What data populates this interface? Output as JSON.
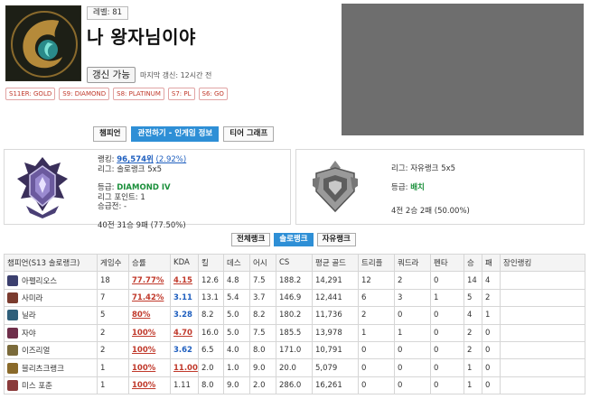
{
  "profile": {
    "level_label": "레벨: 81",
    "summoner_name": "나 왕자님이야",
    "renew_label": "갱신 가능",
    "last_update": "마지막 갱신: 12시간 전",
    "season_badges": [
      "S11ER: GOLD",
      "S9: DIAMOND",
      "S8: PLATINUM",
      "S7: PL",
      "S6: GO"
    ]
  },
  "tabs": [
    "챔피언",
    "관전하기 - 인게임 정보",
    "티어 그래프"
  ],
  "active_tab": 1,
  "solo_rank": {
    "rank_label": "랭킹: ",
    "rank_value": "96,574위",
    "rank_percent": "(2.92%)",
    "league": "리그: 솔로랭크 5x5",
    "tier_label": "등급: ",
    "tier": "DIAMOND IV",
    "league_points": "리그 포인트: 1",
    "promo": "승급전: -",
    "record": "40전 31승 9패 (77.50%)"
  },
  "flex_rank": {
    "league": "리그: 자유랭크 5x5",
    "tier_label": "등급: ",
    "tier": "배치",
    "record": "4전 2승 2패 (50.00%)"
  },
  "queue_buttons": [
    "전체랭크",
    "솔로랭크",
    "자유랭크"
  ],
  "active_queue": 1,
  "table": {
    "headers": [
      "챔피언(S13 솔로랭크)",
      "게임수",
      "승률",
      "KDA",
      "킬",
      "데스",
      "어시",
      "CS",
      "평균 골드",
      "트리플",
      "쿼드라",
      "펜타",
      "승",
      "패",
      "장인랭킹"
    ],
    "rows": [
      {
        "name": "아펠리오스",
        "games": "18",
        "wr": "77.77%",
        "kda": "4.15",
        "k": "12.6",
        "d": "4.8",
        "a": "7.5",
        "cs": "188.2",
        "gold": "14,291",
        "triple": "12",
        "quadra": "2",
        "penta": "0",
        "w": "14",
        "l": "4",
        "rank": "",
        "kda_style": "good",
        "icon_color": "#3b3f6e"
      },
      {
        "name": "사미라",
        "games": "7",
        "wr": "71.42%",
        "kda": "3.11",
        "k": "13.1",
        "d": "5.4",
        "a": "3.7",
        "cs": "146.9",
        "gold": "12,441",
        "triple": "6",
        "quadra": "3",
        "penta": "1",
        "w": "5",
        "l": "2",
        "rank": "",
        "kda_style": "mid",
        "icon_color": "#7a3b2e"
      },
      {
        "name": "닐라",
        "games": "5",
        "wr": "80%",
        "kda": "3.28",
        "k": "8.2",
        "d": "5.0",
        "a": "8.2",
        "cs": "180.2",
        "gold": "11,736",
        "triple": "2",
        "quadra": "0",
        "penta": "0",
        "w": "4",
        "l": "1",
        "rank": "",
        "kda_style": "mid",
        "icon_color": "#2f5f7a"
      },
      {
        "name": "자야",
        "games": "2",
        "wr": "100%",
        "kda": "4.70",
        "k": "16.0",
        "d": "5.0",
        "a": "7.5",
        "cs": "185.5",
        "gold": "13,978",
        "triple": "1",
        "quadra": "1",
        "penta": "0",
        "w": "2",
        "l": "0",
        "rank": "",
        "kda_style": "good",
        "icon_color": "#6e2e4a"
      },
      {
        "name": "이즈리얼",
        "games": "2",
        "wr": "100%",
        "kda": "3.62",
        "k": "6.5",
        "d": "4.0",
        "a": "8.0",
        "cs": "171.0",
        "gold": "10,791",
        "triple": "0",
        "quadra": "0",
        "penta": "0",
        "w": "2",
        "l": "0",
        "rank": "",
        "kda_style": "mid",
        "icon_color": "#7a6a3a"
      },
      {
        "name": "블리츠크랭크",
        "games": "1",
        "wr": "100%",
        "kda": "11.00",
        "k": "2.0",
        "d": "1.0",
        "a": "9.0",
        "cs": "20.0",
        "gold": "5,079",
        "triple": "0",
        "quadra": "0",
        "penta": "0",
        "w": "1",
        "l": "0",
        "rank": "",
        "kda_style": "good",
        "icon_color": "#8a6a2a"
      },
      {
        "name": "미스 포춘",
        "games": "1",
        "wr": "100%",
        "kda": "1.11",
        "k": "8.0",
        "d": "9.0",
        "a": "2.0",
        "cs": "286.0",
        "gold": "16,261",
        "triple": "0",
        "quadra": "0",
        "penta": "0",
        "w": "1",
        "l": "0",
        "rank": "",
        "kda_style": "plain",
        "icon_color": "#8a3a3a"
      }
    ]
  },
  "colors": {
    "accent": "#2e8fd6",
    "win_rate": "#c0392b",
    "tier": "#1a8f3a",
    "link": "#1f5fbf",
    "ad_placeholder": "#6e6e6e"
  },
  "icons": {
    "profile": "crescent-emblem-icon",
    "solo_emblem": "diamond-emblem-icon",
    "flex_emblem": "unranked-emblem-icon"
  }
}
